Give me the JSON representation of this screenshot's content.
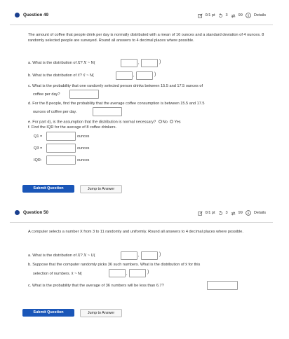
{
  "q49": {
    "title": "Question 49",
    "points": "0/1 pt",
    "retries": "3",
    "attempts": "99",
    "details": "Details",
    "intro": "The amount of coffee that people drink per day is normally distributed with a mean of 16 ounces and a standard deviation of 4 ounces. 8 randomly selected people are surveyed. Round all answers to 4 decimal places where possible.",
    "a_prefix": "a. What is the distribution of ",
    "a_var": "X",
    "a_mid": "? ",
    "a_var2": "X",
    "a_dist": " ~ N(",
    "b_prefix": "b. What is the distribution of ",
    "b_var": "x̄",
    "b_mid": "? ",
    "b_var2": "x̄",
    "b_dist": " ~ N(",
    "c_line1": "c. What is the probability that one randomly selected person drinks between 15.5 and 17.5 ounces of",
    "c_line2": "coffee per day?",
    "d_line1": "d. For the 8 people, find the probability that the average coffee consumption is between 15.5 and 17.5",
    "d_line2": "ounces of coffee per day.",
    "e_text": "e. For part d), is the assumption that the distribution is normal necessary?",
    "e_no": "No",
    "e_yes": "Yes",
    "f_text": "f. Find the IQR for the average of 8 coffee drinkers.",
    "q1_label": "Q1 =",
    "q3_label": "Q3 =",
    "iqr_label": "IQR:",
    "unit": "ounces",
    "submit": "Submit Question",
    "jump": "Jump to Answer"
  },
  "q50": {
    "title": "Question 50",
    "points": "0/1 pt",
    "retries": "3",
    "attempts": "99",
    "details": "Details",
    "intro": "A computer selects a number X from 3 to 11 randomly and uniformly. Round all answers to 4 decimal places where possible.",
    "a_prefix": "a. What is the distribution of ",
    "a_var": "X",
    "a_mid": "? ",
    "a_var2": "X",
    "a_dist": " ~ U(",
    "b_line1": "b. Suppose that the computer randomly picks 36 such numbers.  What is the distribution of x̄ for this",
    "b_line2": "selection of numbers.  x̄ ~ N(",
    "c_text": "c. What is the probability that the average of 36 numbers will be less than 6.7?",
    "submit": "Submit Question",
    "jump": "Jump to Answer"
  },
  "colors": {
    "accent": "#1a56b8",
    "bullet": "#1a3f8f"
  }
}
